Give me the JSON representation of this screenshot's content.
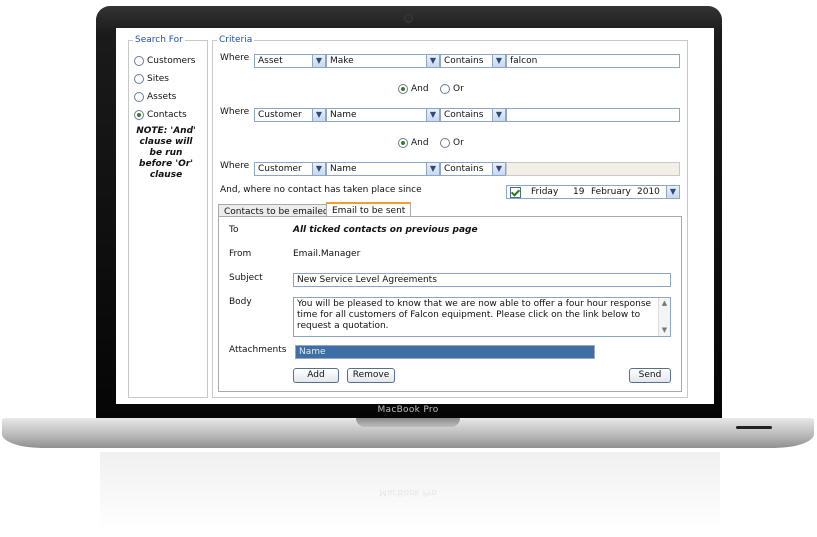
{
  "device": {
    "brand": "MacBook Pro"
  },
  "search_for": {
    "legend": "Search For",
    "options": [
      {
        "label": "Customers",
        "selected": false
      },
      {
        "label": "Sites",
        "selected": false
      },
      {
        "label": "Assets",
        "selected": false
      },
      {
        "label": "Contacts",
        "selected": true
      }
    ],
    "note_lines": [
      "NOTE: 'And'",
      "clause will",
      "be run",
      "before 'Or'",
      "clause"
    ]
  },
  "criteria": {
    "legend": "Criteria",
    "rows": [
      {
        "where": "Where",
        "entity": "Asset",
        "field": "Make",
        "operator": "Contains",
        "value": "falcon"
      },
      {
        "where": "Where",
        "entity": "Customer",
        "field": "Name",
        "operator": "Contains",
        "value": ""
      },
      {
        "where": "Where",
        "entity": "Customer",
        "field": "Name",
        "operator": "Contains",
        "value": ""
      }
    ],
    "conjunctions": [
      {
        "and": "And",
        "or": "Or",
        "selected": "And"
      },
      {
        "and": "And",
        "or": "Or",
        "selected": "And"
      }
    ],
    "since_label": "And, where no contact has taken place since",
    "since_date": {
      "day": "Friday",
      "date": "19",
      "month": "February",
      "year": "2010"
    }
  },
  "tabs": [
    {
      "label": "Contacts to be emailed",
      "active": false
    },
    {
      "label": "Email to be sent",
      "active": true
    }
  ],
  "email": {
    "to_label": "To",
    "to_value": "All ticked contacts on previous page",
    "from_label": "From",
    "from_value": "Email.Manager",
    "subject_label": "Subject",
    "subject_value": "New Service Level Agreements",
    "body_label": "Body",
    "body_lines": [
      "You will be pleased to know that we are now able to offer a four hour response",
      "time for all customers of Falcon equipment. Please click on the link below to",
      "request a quotation."
    ],
    "attachments_label": "Attachments",
    "attachments_column": "Name",
    "add_label": "Add",
    "remove_label": "Remove",
    "send_label": "Send"
  },
  "icons": {
    "dropdown": "chevron-down-icon",
    "scroll_up": "scroll-up-icon",
    "scroll_down": "scroll-down-icon"
  },
  "colors": {
    "legend": "#1f4fb0",
    "list_header": "#3d6fa6",
    "active_tab": "#f0a030"
  }
}
